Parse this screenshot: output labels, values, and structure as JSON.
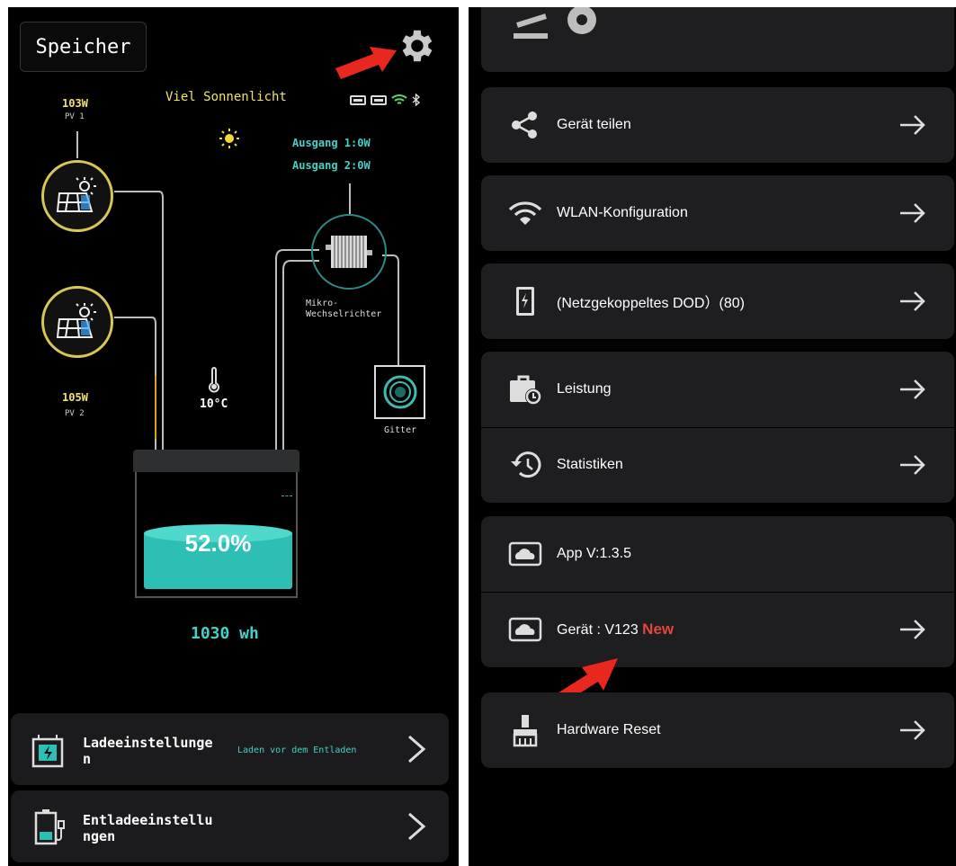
{
  "left": {
    "title": "Speicher",
    "weather": "Viel Sonnenlicht",
    "pv1": {
      "power": "103W",
      "name": "PV 1"
    },
    "pv2": {
      "power": "105W",
      "name": "PV 2"
    },
    "outputs": [
      "Ausgang 1:0W",
      "Ausgang 2:0W"
    ],
    "inverter_label": [
      "Mikro-",
      "Wechselrichter"
    ],
    "temperature": "10°C",
    "grid_label": "Gitter",
    "battery_percent": "52.0%",
    "battery_level": 0.52,
    "energy": "1030 wh",
    "charge_settings": {
      "label": [
        "Ladeeinstellunge",
        "n"
      ],
      "hint": "Laden vor dem Entladen"
    },
    "discharge_settings": {
      "label": [
        "Entladeeinstellu",
        "ngen"
      ]
    }
  },
  "right": {
    "items": [
      {
        "label": "Gerät teilen",
        "icon": "share-icon"
      },
      {
        "label": "WLAN-Konfiguration",
        "icon": "wifi-icon"
      },
      {
        "label": "(Netzgekoppeltes DOD）(80)",
        "icon": "battery-charge-icon"
      },
      {
        "label": "Leistung",
        "icon": "briefcase-clock-icon"
      },
      {
        "label": "Statistiken",
        "icon": "history-icon"
      },
      {
        "label": "App V:1.3.5",
        "icon": "cloud-icon"
      },
      {
        "label": "Gerät : V123",
        "badge": "New",
        "icon": "cloud-icon"
      },
      {
        "label": "Hardware Reset",
        "icon": "broom-icon"
      }
    ]
  },
  "colors": {
    "accent_yellow": "#f3e26a",
    "accent_cyan": "#44d1c6",
    "battery_fill": "#2dbfb4",
    "new_badge": "#e2473d",
    "arrow": "#e8281f"
  }
}
